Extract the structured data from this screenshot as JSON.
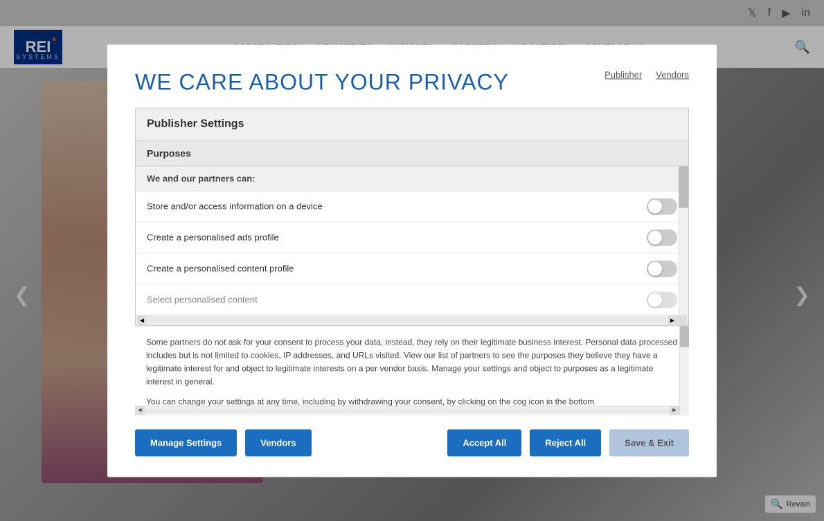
{
  "topbar": {
    "icons": [
      "twitter",
      "facebook",
      "youtube",
      "linkedin"
    ]
  },
  "navbar": {
    "logo": "REI",
    "logo_sub": "SYSTEMS",
    "links": [
      "CAPABILITIES",
      "INDUSTRIES",
      "INSIGHTS",
      "CAREERS",
      "ABOUT REI",
      "CONTACT US"
    ]
  },
  "modal": {
    "title": "WE CARE ABOUT YOUR PRIVACY",
    "tabs": {
      "publisher": "Publisher",
      "vendors": "Vendors"
    },
    "settings_header": "Publisher Settings",
    "purposes_header": "Purposes",
    "partners_header": "We and our partners can:",
    "toggles": [
      {
        "label": "Store and/or access information on a device",
        "enabled": false
      },
      {
        "label": "Create a personalised ads profile",
        "enabled": false
      },
      {
        "label": "Create a personalised content profile",
        "enabled": false
      },
      {
        "label": "Select personalised content",
        "enabled": false
      }
    ],
    "body_text_1": "Some partners do not ask for your consent to process your data, instead, they rely on their legitimate business interest. Personal data processed includes but is not limited to cookies, IP addresses, and URLs visited. View our list of partners to see the purposes they believe they have a legitimate interest for and object to legitimate interests on a per vendor basis. Manage your settings and object to purposes as a legitimate interest in general.",
    "body_text_2": "You can change your settings at any time, including by withdrawing your consent, by clicking on the cog icon in the bottom",
    "buttons": {
      "manage_settings": "Manage Settings",
      "vendors": "Vendors",
      "accept_all": "Accept All",
      "reject_all": "Reject All",
      "save_exit": "Save & Exit"
    }
  },
  "revain": "Revain"
}
